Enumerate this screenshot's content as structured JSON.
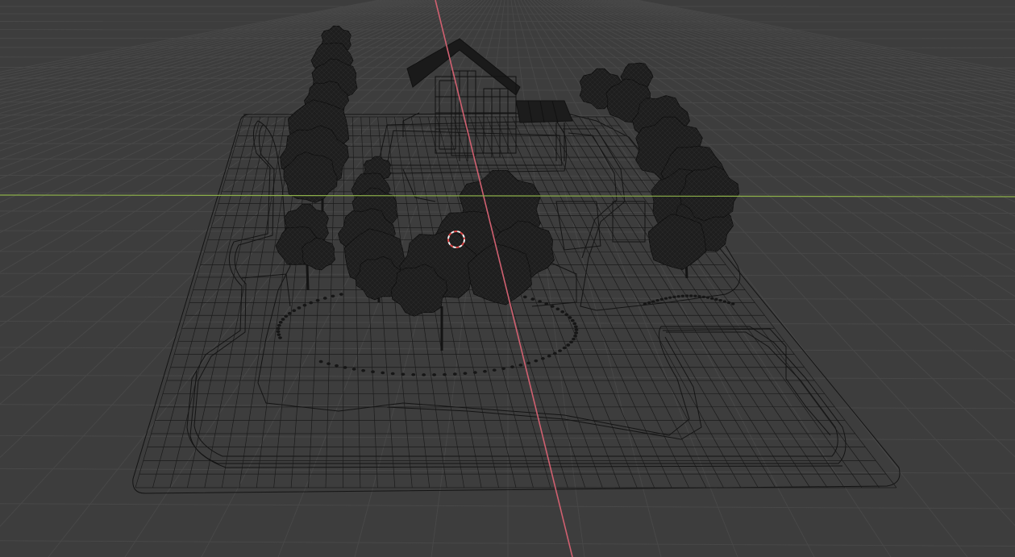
{
  "viewport": {
    "background_color": "#3d3d3d",
    "grid_color": "#484848",
    "wireframe_color": "#141414",
    "x_axis_color": "#d06070",
    "y_axis_color": "#8db04a",
    "cursor_colors": [
      "#e04848",
      "#f0f0f0"
    ],
    "view_mode": "wireframe"
  },
  "scene": {
    "objects": [
      {
        "name": "cabin",
        "icon": "house-icon"
      },
      {
        "name": "trees",
        "icon": "tree-icon"
      },
      {
        "name": "terrain-plane",
        "icon": "mesh-grid-icon"
      },
      {
        "name": "stone-path",
        "icon": "path-icon"
      },
      {
        "name": "benches",
        "icon": "bench-icon"
      }
    ]
  }
}
